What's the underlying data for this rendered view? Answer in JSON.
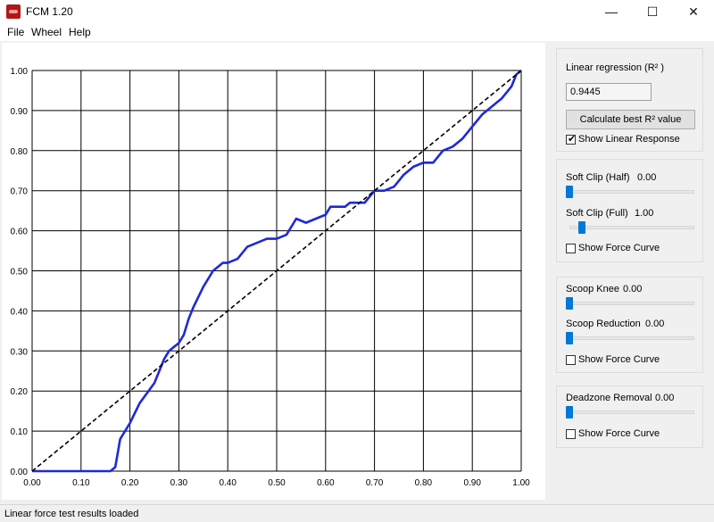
{
  "window": {
    "title": "FCM 1.20",
    "controls": {
      "minimize": "—",
      "maximize": "☐",
      "close": "✕"
    }
  },
  "menu": [
    "File",
    "Wheel",
    "Help"
  ],
  "regression": {
    "label": "Linear regression (R² )",
    "value": "0.9445",
    "calc_button": "Calculate best R² value",
    "show_linear_label": "Show Linear Response",
    "show_linear_checked": true
  },
  "soft_clip": {
    "half_label": "Soft Clip (Half)",
    "half_value": "0.00",
    "half_level": 0.0,
    "full_label": "Soft Clip (Full)",
    "full_value": "1.00",
    "full_level": 0.1,
    "show_curve_label": "Show Force Curve",
    "show_curve_checked": false
  },
  "scoop": {
    "knee_label": "Scoop Knee",
    "knee_value": "0.00",
    "knee_level": 0.0,
    "reduction_label": "Scoop Reduction",
    "reduction_value": "0.00",
    "reduction_level": 0.0,
    "show_curve_label": "Show Force Curve",
    "show_curve_checked": false
  },
  "deadzone": {
    "label": "Deadzone Removal",
    "value": "0.00",
    "level": 0.0,
    "show_curve_label": "Show Force Curve",
    "show_curve_checked": false
  },
  "status": "Linear force test results loaded",
  "colors": {
    "measured": "#1f28d8",
    "linear": "#000000",
    "slider": "#0078d7"
  },
  "chart_data": {
    "type": "line",
    "xlim": [
      0,
      1
    ],
    "ylim": [
      0,
      1
    ],
    "grid": true,
    "xticks": [
      "0.00",
      "0.10",
      "0.20",
      "0.30",
      "0.40",
      "0.50",
      "0.60",
      "0.70",
      "0.80",
      "0.90",
      "1.00"
    ],
    "yticks": [
      "0.00",
      "0.10",
      "0.20",
      "0.30",
      "0.40",
      "0.50",
      "0.60",
      "0.70",
      "0.80",
      "0.90",
      "1.00"
    ],
    "series": [
      {
        "style": "solid",
        "x": [
          0.0,
          0.1,
          0.16,
          0.17,
          0.18,
          0.2,
          0.22,
          0.25,
          0.27,
          0.28,
          0.29,
          0.3,
          0.31,
          0.32,
          0.33,
          0.35,
          0.37,
          0.38,
          0.39,
          0.4,
          0.42,
          0.44,
          0.46,
          0.48,
          0.5,
          0.52,
          0.54,
          0.56,
          0.58,
          0.6,
          0.61,
          0.62,
          0.63,
          0.64,
          0.65,
          0.66,
          0.68,
          0.7,
          0.72,
          0.74,
          0.76,
          0.78,
          0.8,
          0.82,
          0.84,
          0.86,
          0.88,
          0.9,
          0.92,
          0.94,
          0.96,
          0.98,
          0.99,
          1.0
        ],
        "y": [
          0.0,
          0.0,
          0.0,
          0.01,
          0.08,
          0.12,
          0.17,
          0.22,
          0.28,
          0.3,
          0.31,
          0.32,
          0.34,
          0.38,
          0.41,
          0.46,
          0.5,
          0.51,
          0.52,
          0.52,
          0.53,
          0.56,
          0.57,
          0.58,
          0.58,
          0.59,
          0.63,
          0.62,
          0.63,
          0.64,
          0.66,
          0.66,
          0.66,
          0.66,
          0.67,
          0.67,
          0.67,
          0.7,
          0.7,
          0.71,
          0.74,
          0.76,
          0.77,
          0.77,
          0.8,
          0.81,
          0.83,
          0.86,
          0.89,
          0.91,
          0.93,
          0.96,
          0.99,
          1.0
        ]
      },
      {
        "style": "dashed",
        "x": [
          0.0,
          1.0
        ],
        "y": [
          0.0,
          1.0
        ]
      }
    ]
  }
}
